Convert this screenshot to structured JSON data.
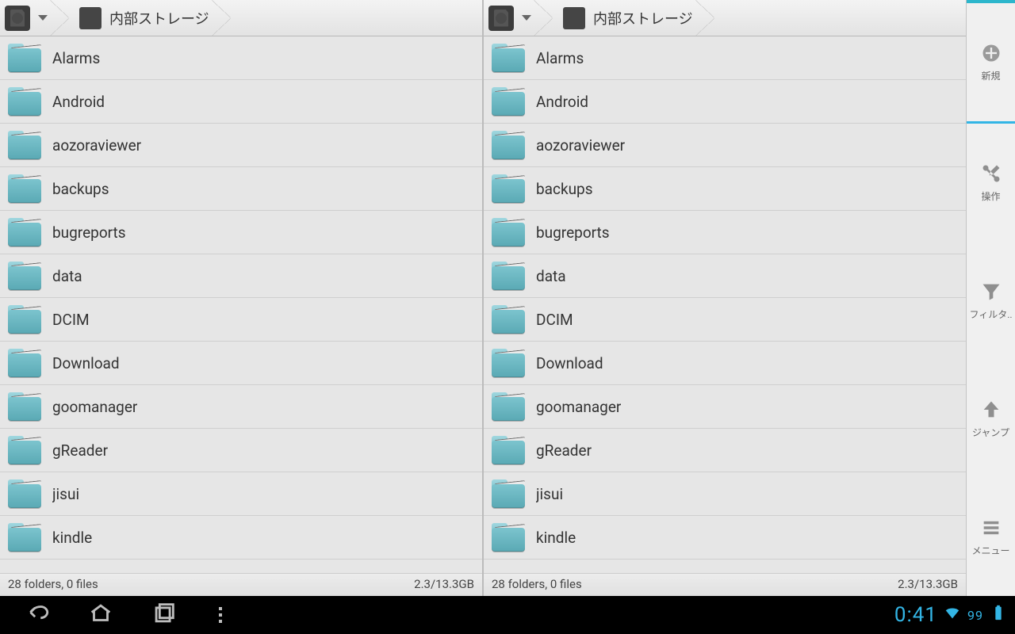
{
  "panes": [
    {
      "breadcrumb_root_label": "",
      "breadcrumb_location": "内部ストレージ",
      "folders": [
        "Alarms",
        "Android",
        "aozoraviewer",
        "backups",
        "bugreports",
        "data",
        "DCIM",
        "Download",
        "goomanager",
        "gReader",
        "jisui",
        "kindle"
      ],
      "status_left": "28 folders, 0 files",
      "status_right": "2.3/13.3GB"
    },
    {
      "breadcrumb_root_label": "",
      "breadcrumb_location": "内部ストレージ",
      "folders": [
        "Alarms",
        "Android",
        "aozoraviewer",
        "backups",
        "bugreports",
        "data",
        "DCIM",
        "Download",
        "goomanager",
        "gReader",
        "jisui",
        "kindle"
      ],
      "status_left": "28 folders, 0 files",
      "status_right": "2.3/13.3GB"
    }
  ],
  "actions": {
    "new": "新規",
    "operate": "操作",
    "filter": "フィルタ..",
    "jump": "ジャンプ",
    "menu": "メニュー"
  },
  "navbar": {
    "clock": "0:41",
    "battery": "99"
  }
}
